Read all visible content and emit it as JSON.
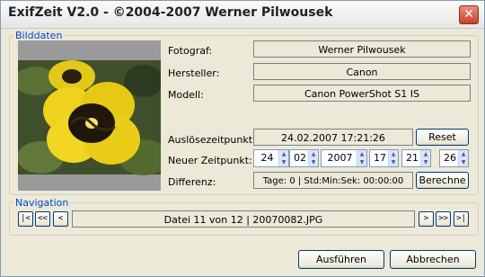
{
  "window": {
    "title": "ExifZeit V2.0 - ©2004-2007 Werner Pilwousek",
    "close_symbol": "✕"
  },
  "bilddaten": {
    "legend": "Bilddaten",
    "fotograf_label": "Fotograf:",
    "fotograf_value": "Werner Pilwousek",
    "hersteller_label": "Hersteller:",
    "hersteller_value": "Canon",
    "modell_label": "Modell:",
    "modell_value": "Canon PowerShot S1 IS",
    "ausloese_label": "Auslösezeitpunkt:",
    "ausloese_value": "24.02.2007 17:21:26",
    "reset_label": "Reset",
    "neuer_label": "Neuer Zeitpunkt:",
    "neuer": {
      "day": "24",
      "month": "02",
      "year": "2007",
      "hour": "17",
      "minute": "21",
      "second": "26"
    },
    "differenz_label": "Differenz:",
    "differenz_value": "Tage: 0 | Std:Min:Sek: 00:00:00",
    "berechne_label": "Berechne"
  },
  "navigation": {
    "legend": "Navigation",
    "first_symbol": "|<",
    "prev_fast_symbol": "<<",
    "prev_symbol": "<",
    "file_info": "Datei 11 von 12 | 20070082.JPG",
    "next_symbol": ">",
    "next_fast_symbol": ">>",
    "last_symbol": ">|"
  },
  "footer": {
    "ausfuehren_label": "Ausführen",
    "abbrechen_label": "Abbrechen"
  },
  "colors": {
    "legend_text": "#0046d5",
    "background": "#ece9d8",
    "close_button": "#c9422b"
  }
}
